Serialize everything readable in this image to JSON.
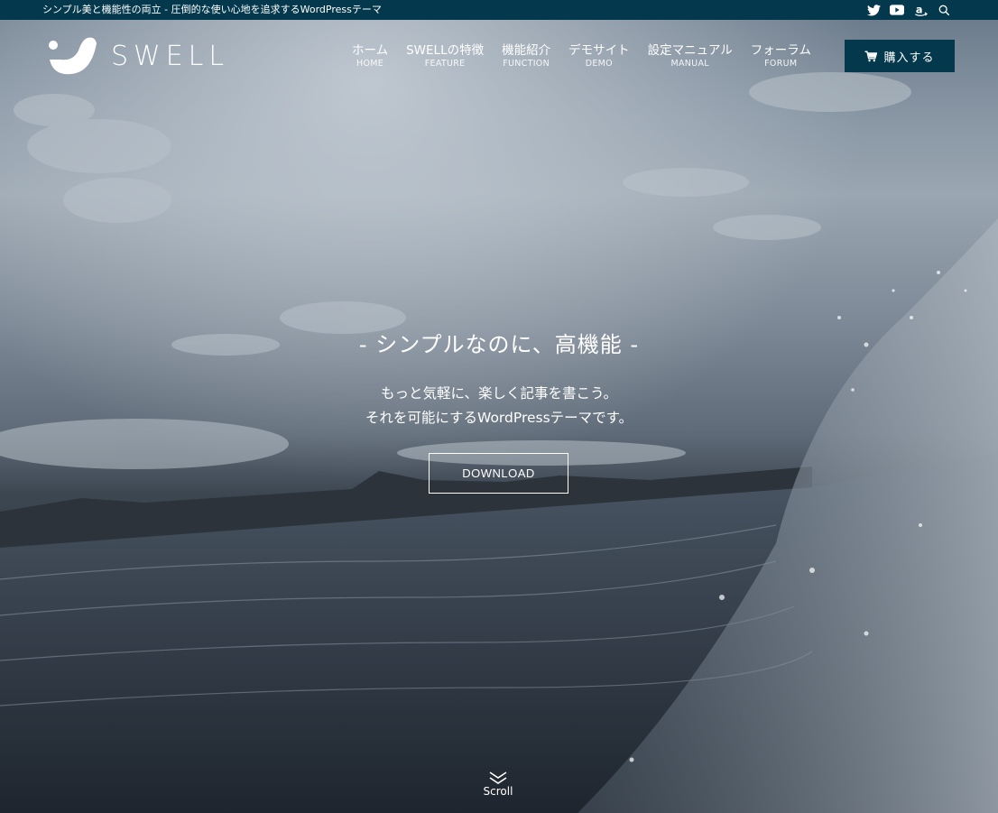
{
  "topbar": {
    "tagline": "シンプル美と機能性の両立 - 圧倒的な使い心地を追求するWordPressテーマ",
    "icons": [
      "twitter-icon",
      "youtube-icon",
      "amazon-icon",
      "search-icon"
    ]
  },
  "header": {
    "logo_text": "SWELL",
    "nav": [
      {
        "ja": "ホーム",
        "en": "HOME"
      },
      {
        "ja": "SWELLの特徴",
        "en": "FEATURE"
      },
      {
        "ja": "機能紹介",
        "en": "FUNCTION"
      },
      {
        "ja": "デモサイト",
        "en": "DEMO"
      },
      {
        "ja": "設定マニュアル",
        "en": "MANUAL"
      },
      {
        "ja": "フォーラム",
        "en": "FORUM"
      }
    ],
    "buy_label": "購入する"
  },
  "hero": {
    "catch_main": "- シンプルなのに、高機能 -",
    "catch_sub_1": "もっと気軽に、楽しく記事を書こう。",
    "catch_sub_2": "それを可能にするWordPressテーマです。",
    "download_label": "DOWNLOAD",
    "scroll_label": "Scroll"
  },
  "colors": {
    "brand": "#04384c",
    "text": "#ffffff"
  }
}
